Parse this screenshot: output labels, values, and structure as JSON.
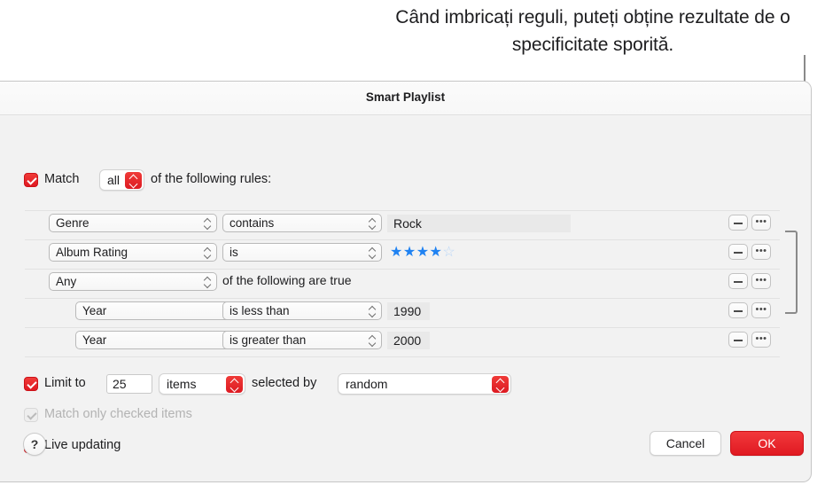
{
  "annotation": {
    "text": "Când imbricați reguli, puteți obține rezultate de o specificitate sporită."
  },
  "window": {
    "title": "Smart Playlist"
  },
  "match": {
    "checkbox_checked": true,
    "label": "Match",
    "operator_value": "all",
    "suffix_label": "of the following rules:"
  },
  "rules": [
    {
      "field": "Genre",
      "condition": "contains",
      "value": "Rock",
      "value_type": "text",
      "indent": 0,
      "remove_label": "remove-rule",
      "more_label": "more-options"
    },
    {
      "field": "Album Rating",
      "condition": "is",
      "value": "4",
      "value_type": "stars",
      "stars_filled": 4,
      "stars_total": 5,
      "indent": 0
    },
    {
      "field": "Any",
      "condition": "",
      "value": "",
      "value_type": "group",
      "group_suffix": "of the following are true",
      "indent": 0
    },
    {
      "field": "Year",
      "condition": "is less than",
      "value": "1990",
      "value_type": "text",
      "indent": 1
    },
    {
      "field": "Year",
      "condition": "is greater than",
      "value": "2000",
      "value_type": "text",
      "indent": 1
    }
  ],
  "limit": {
    "checkbox_checked": true,
    "label": "Limit to",
    "amount": "25",
    "unit_value": "items",
    "selected_by_label": "selected by",
    "order_value": "random"
  },
  "match_only_checked": {
    "checkbox_checked": true,
    "enabled": false,
    "label": "Match only checked items"
  },
  "live_updating": {
    "checkbox_checked": true,
    "label": "Live updating"
  },
  "footer": {
    "help_label": "?",
    "cancel_label": "Cancel",
    "ok_label": "OK"
  },
  "colors": {
    "accent_red": "#e01a22",
    "star_blue": "#1f82f2",
    "star_empty": "#b9d6f7",
    "window_bg": "#f2f2f2",
    "callout_line": "#8a8a8a"
  }
}
